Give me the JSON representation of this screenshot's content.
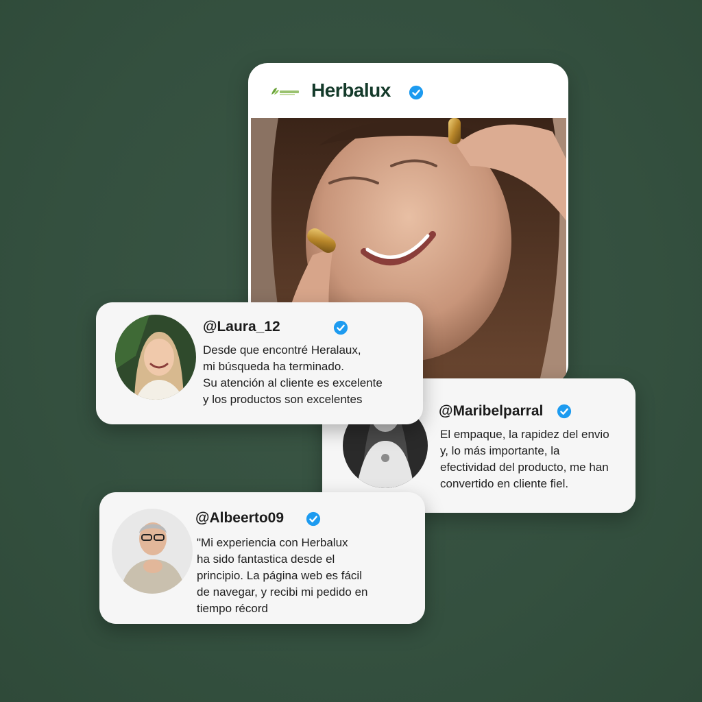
{
  "colors": {
    "background": "#36503f",
    "card": "#f6f6f6",
    "brand_text": "#143a2a",
    "verified_badge": "#1d9bf0"
  },
  "post": {
    "brand_name": "Herbalux",
    "brand_logo_icon": "herbalux-leaf-logo",
    "verified_icon": "verified-badge-icon",
    "photo_description_icon": "woman-holding-capsules-photo"
  },
  "reviews": [
    {
      "handle": "@Laura_12",
      "lines": [
        "Desde que encontré Heralaux,",
        "mi búsqueda ha terminado.",
        "Su atención al cliente es excelente",
        "y los productos son excelentes"
      ]
    },
    {
      "handle": "@Maribelparral",
      "lines": [
        "El empaque, la rapidez del envio",
        "y, lo más importante, la",
        "efectividad del producto, me han",
        "convertido en cliente fiel."
      ]
    },
    {
      "handle": "@Albeerto09",
      "lines": [
        "\"Mi experiencia con Herbalux",
        "ha sido fantastica desde el",
        "principio. La página web es fácil",
        "de navegar, y recibi mi pedido en",
        "tiempo récord"
      ]
    }
  ]
}
